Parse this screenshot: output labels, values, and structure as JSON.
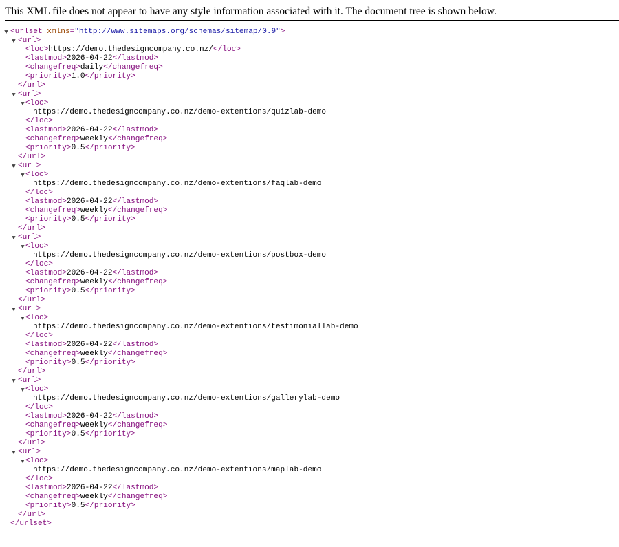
{
  "header": {
    "message": "This XML file does not appear to have any style information associated with it. The document tree is shown below."
  },
  "tree": {
    "root_open_tag": "<urlset",
    "root_attr_name": "xmlns",
    "root_attr_eq": "=",
    "root_attr_value": "\"http://www.sitemaps.org/schemas/sitemap/0.9\"",
    "root_open_tag_end": ">",
    "root_close_tag": "</urlset>",
    "url_open": "<url>",
    "url_close": "</url>",
    "loc_open": "<loc>",
    "loc_close": "</loc>",
    "lastmod_open": "<lastmod>",
    "lastmod_close": "</lastmod>",
    "changefreq_open": "<changefreq>",
    "changefreq_close": "</changefreq>",
    "priority_open": "<priority>",
    "priority_close": "</priority>",
    "urls": [
      {
        "loc": "https://demo.thedesigncompany.co.nz/",
        "lastmod": "2026-04-22",
        "changefreq": "daily",
        "priority": "1.0"
      },
      {
        "loc": "https://demo.thedesigncompany.co.nz/demo-extentions/quizlab-demo",
        "lastmod": "2026-04-22",
        "changefreq": "weekly",
        "priority": "0.5"
      },
      {
        "loc": "https://demo.thedesigncompany.co.nz/demo-extentions/faqlab-demo",
        "lastmod": "2026-04-22",
        "changefreq": "weekly",
        "priority": "0.5"
      },
      {
        "loc": "https://demo.thedesigncompany.co.nz/demo-extentions/postbox-demo",
        "lastmod": "2026-04-22",
        "changefreq": "weekly",
        "priority": "0.5"
      },
      {
        "loc": "https://demo.thedesigncompany.co.nz/demo-extentions/testimoniallab-demo",
        "lastmod": "2026-04-22",
        "changefreq": "weekly",
        "priority": "0.5"
      },
      {
        "loc": "https://demo.thedesigncompany.co.nz/demo-extentions/gallerylab-demo",
        "lastmod": "2026-04-22",
        "changefreq": "weekly",
        "priority": "0.5"
      },
      {
        "loc": "https://demo.thedesigncompany.co.nz/demo-extentions/maplab-demo",
        "lastmod": "2026-04-22",
        "changefreq": "weekly",
        "priority": "0.5"
      }
    ]
  }
}
